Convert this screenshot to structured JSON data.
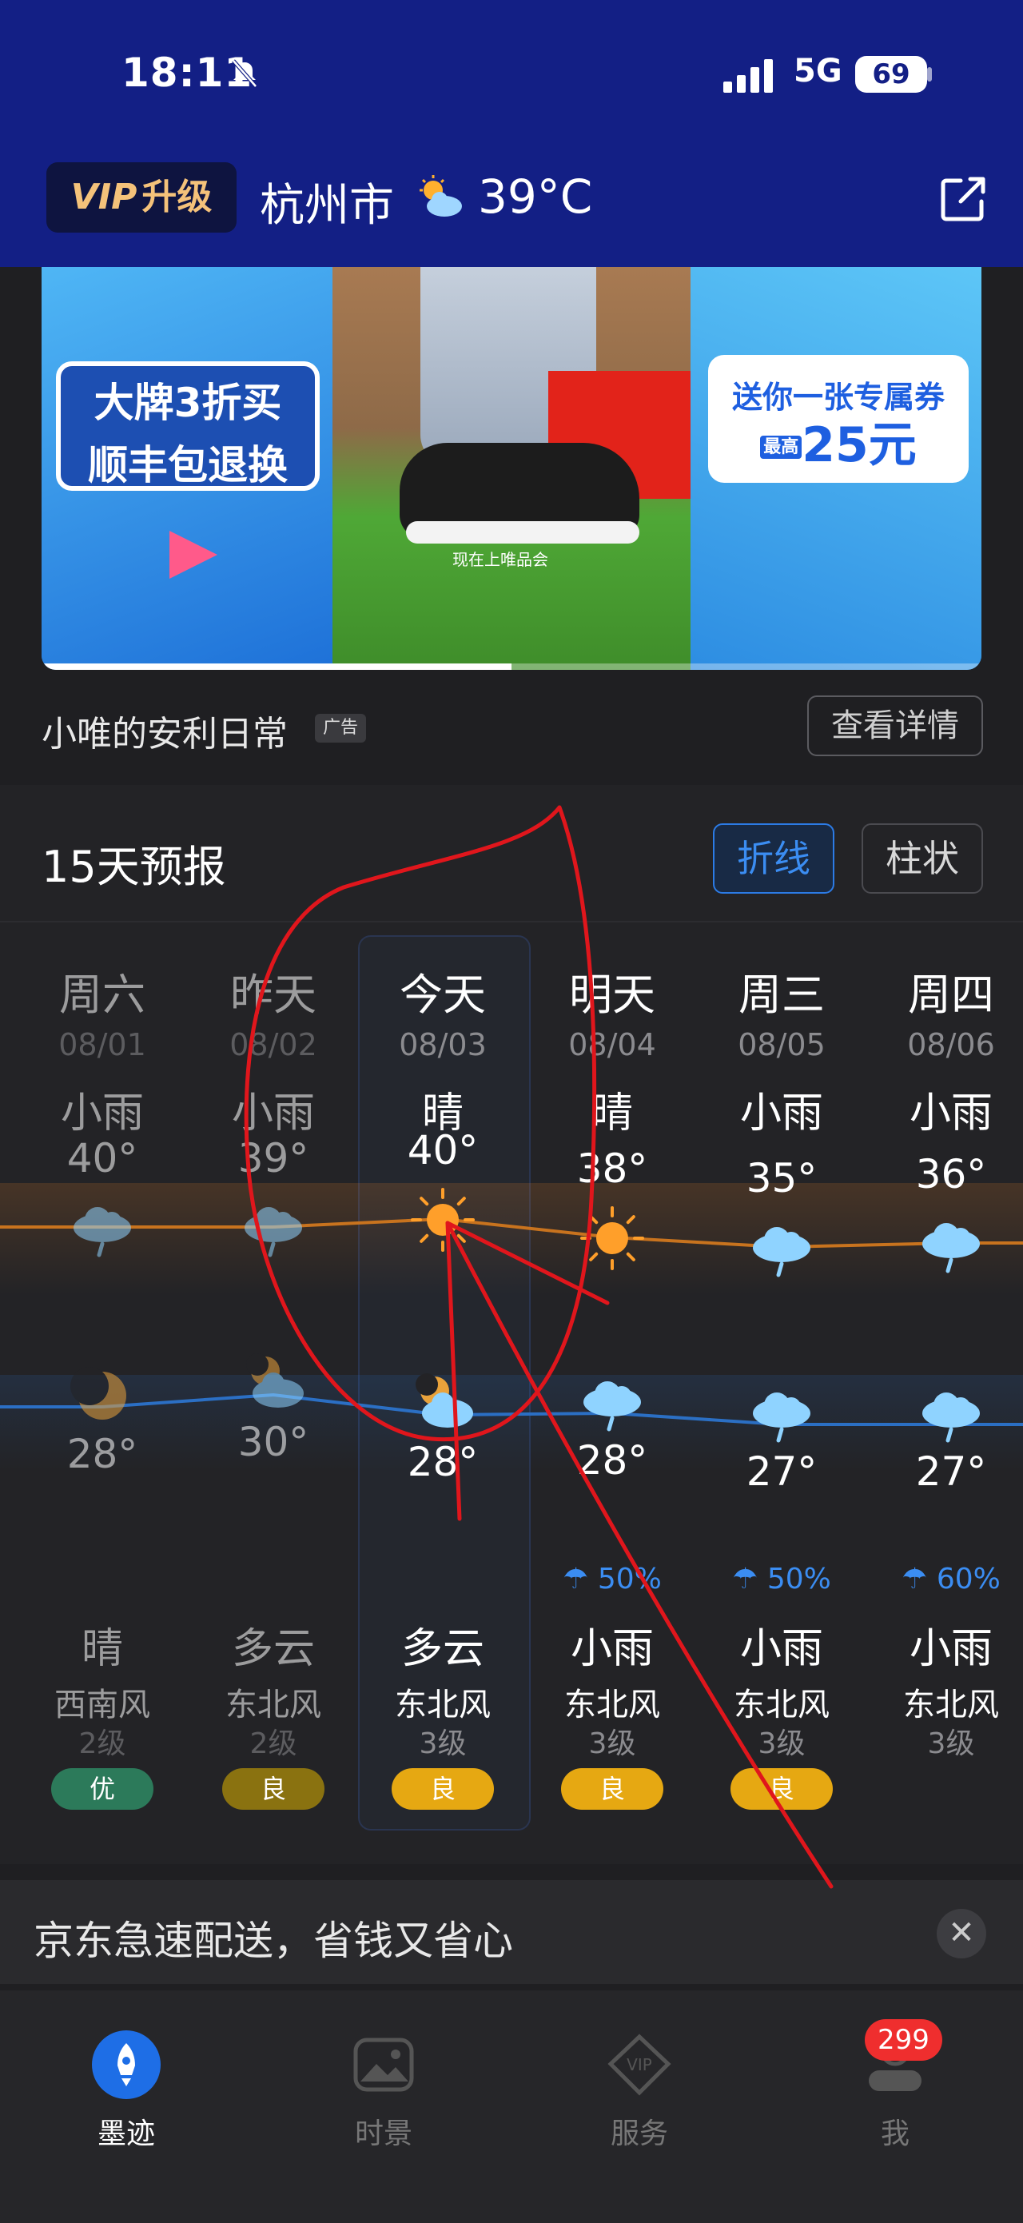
{
  "status_bar": {
    "time": "18:11",
    "network": "5G",
    "battery": "69"
  },
  "header": {
    "vip_label_en": "VIP",
    "vip_label_cn": "升级",
    "city": "杭州市",
    "temperature": "39°C"
  },
  "ad_banner": {
    "left_text_line1": "大牌3折买",
    "left_text_line2": "顺丰包退换",
    "right_text_line1": "送你一张专属券",
    "right_text_line2": "25元",
    "right_prefix": "最高",
    "caption": "现在上唯品会",
    "progress": 0.5
  },
  "ad_info": {
    "title": "小唯的安利日常",
    "badge": "广告",
    "detail_button": "查看详情"
  },
  "forecast": {
    "title": "15天预报",
    "toggle_line": "折线",
    "toggle_bar": "柱状",
    "days": [
      {
        "day": "周六",
        "date": "08/01",
        "day_cond": "小雨",
        "high": "40°",
        "low": "28°",
        "rain": "",
        "night_cond": "晴",
        "wind": "西南风",
        "level": "2级",
        "aqi": "优",
        "aqi_color": "#2c7a5a",
        "past": true,
        "day_icon": "rain-cloud-icon",
        "night_icon": "moon-icon"
      },
      {
        "day": "昨天",
        "date": "08/02",
        "day_cond": "小雨",
        "high": "39°",
        "low": "30°",
        "rain": "",
        "night_cond": "多云",
        "wind": "东北风",
        "level": "2级",
        "aqi": "良",
        "aqi_color": "#8a7210",
        "past": true,
        "day_icon": "rain-cloud-icon",
        "night_icon": "moon-cloud-icon"
      },
      {
        "day": "今天",
        "date": "08/03",
        "day_cond": "晴",
        "high": "40°",
        "low": "28°",
        "rain": "",
        "night_cond": "多云",
        "wind": "东北风",
        "level": "3级",
        "aqi": "良",
        "aqi_color": "#e6a812",
        "past": false,
        "day_icon": "sun-icon",
        "night_icon": "moon-cloud-icon"
      },
      {
        "day": "明天",
        "date": "08/04",
        "day_cond": "晴",
        "high": "38°",
        "low": "28°",
        "rain": "50%",
        "night_cond": "小雨",
        "wind": "东北风",
        "level": "3级",
        "aqi": "良",
        "aqi_color": "#e6a812",
        "past": false,
        "day_icon": "sun-icon",
        "night_icon": "rain-cloud-icon"
      },
      {
        "day": "周三",
        "date": "08/05",
        "day_cond": "小雨",
        "high": "35°",
        "low": "27°",
        "rain": "50%",
        "night_cond": "小雨",
        "wind": "东北风",
        "level": "3级",
        "aqi": "良",
        "aqi_color": "#e6a812",
        "past": false,
        "day_icon": "rain-cloud-icon",
        "night_icon": "rain-cloud-icon"
      },
      {
        "day": "周四",
        "date": "08/06",
        "day_cond": "小雨",
        "high": "36°",
        "low": "27°",
        "rain": "60%",
        "night_cond": "小雨",
        "wind": "东北风",
        "level": "3级",
        "aqi": "",
        "aqi_color": "",
        "past": false,
        "day_icon": "rain-cloud-icon",
        "night_icon": "rain-cloud-icon"
      }
    ]
  },
  "bottom_ad": {
    "text": "京东急速配送，省钱又省心",
    "close": "✕"
  },
  "nav": {
    "items": [
      {
        "label": "墨迹",
        "active": true,
        "icon": "rocket-icon"
      },
      {
        "label": "时景",
        "active": false,
        "icon": "picture-icon"
      },
      {
        "label": "服务",
        "active": false,
        "icon": "vip-diamond-icon"
      },
      {
        "label": "我",
        "active": false,
        "icon": "profile-icon"
      }
    ],
    "badge": "299"
  },
  "colors": {
    "header_bg": "#131f85",
    "accent_blue": "#2c7be5",
    "high_line": "#c8731e",
    "low_line": "#2b6fc4",
    "annotation": "#e0161c"
  }
}
